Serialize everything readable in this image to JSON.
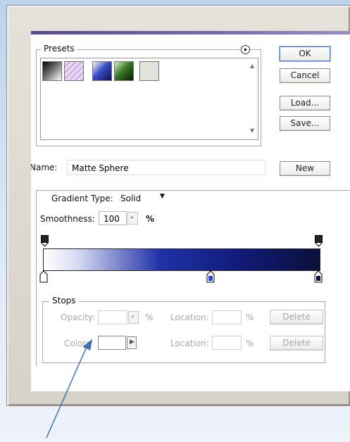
{
  "presets": {
    "legend": "Presets",
    "menu_icon": "circle-arrow-icon",
    "swatches": [
      {
        "name": "black-white",
        "colors": [
          "#000000",
          "#ffffff"
        ]
      },
      {
        "name": "transparent-stripes",
        "colors": [
          "#c8a8d8",
          "#e8d8f0"
        ]
      },
      {
        "name": "matte-sphere-blue",
        "colors": [
          "#ffffff",
          "#2a3fb8",
          "#0a124a"
        ]
      },
      {
        "name": "green-black",
        "colors": [
          "#b8e8a0",
          "#2f6a20",
          "#071a05"
        ]
      },
      {
        "name": "checker-rainbow",
        "colors": [
          "#f6d7a0",
          "#c7e0f8",
          "#f8c8e6"
        ]
      }
    ]
  },
  "buttons": {
    "ok": "OK",
    "cancel": "Cancel",
    "load": "Load...",
    "save": "Save...",
    "new": "New"
  },
  "name_row": {
    "label": "Name:",
    "value": "Matte Sphere"
  },
  "gradient_type": {
    "label": "Gradient Type:",
    "value": "Solid"
  },
  "smoothness": {
    "label": "Smoothness:",
    "value": "100",
    "unit": "%"
  },
  "gradient": {
    "colors": [
      "#ffffff",
      "#d9dcf2",
      "#2032a8",
      "#111b7a",
      "#0b0f3a"
    ]
  },
  "stops": {
    "legend": "Stops",
    "opacity_label": "Opacity:",
    "opacity_unit": "%",
    "color_label": "Color:",
    "location_label": "Location:",
    "location_unit": "%",
    "delete_label": "Delete"
  },
  "annotation": {
    "arrow_color": "#3e6fb0"
  }
}
